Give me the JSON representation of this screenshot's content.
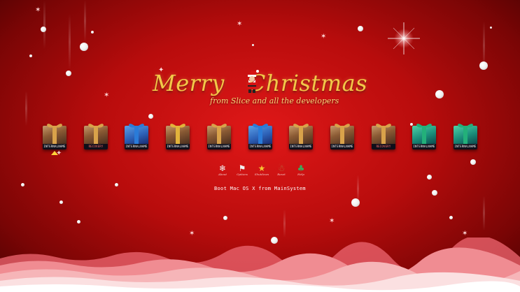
{
  "header": {
    "title_left": "Merry",
    "title_right": "Christmas",
    "subtitle": "from Slice and all the developers"
  },
  "entries": [
    {
      "label": "INTERNALNAME",
      "style": "brown",
      "selected": true
    },
    {
      "label": "RECOVERY",
      "style": "brown",
      "recovery": true
    },
    {
      "label": "INTERNALNAME",
      "style": "blue"
    },
    {
      "label": "INTERNALNAME",
      "style": "gold"
    },
    {
      "label": "INTERNALNAME",
      "style": "brown"
    },
    {
      "label": "INTERNALNAME",
      "style": "blue"
    },
    {
      "label": "INTERNALNAME",
      "style": "brown"
    },
    {
      "label": "INTERNALNAME",
      "style": "brown"
    },
    {
      "label": "RECOVERY",
      "style": "brown",
      "recovery": true
    },
    {
      "label": "INTERNALNAME",
      "style": "green"
    },
    {
      "label": "INTERNALNAME",
      "style": "green"
    }
  ],
  "tools": [
    {
      "name": "candy-cane-icon",
      "glyph": "❄",
      "caption": "About"
    },
    {
      "name": "flag-icon",
      "glyph": "⚑",
      "caption": "Options"
    },
    {
      "name": "star-icon",
      "glyph": "★",
      "caption": "Shutdown"
    },
    {
      "name": "gingerbread-icon",
      "glyph": "☃",
      "caption": "Reset"
    },
    {
      "name": "tree-icon",
      "glyph": "♣",
      "caption": "Help"
    }
  ],
  "status": {
    "boot_message": "Boot Mac OS X from MainSystem"
  },
  "colors": {
    "background": "#c00e0e",
    "title_gold": "#f2c848",
    "selection": "#ffd23a"
  }
}
